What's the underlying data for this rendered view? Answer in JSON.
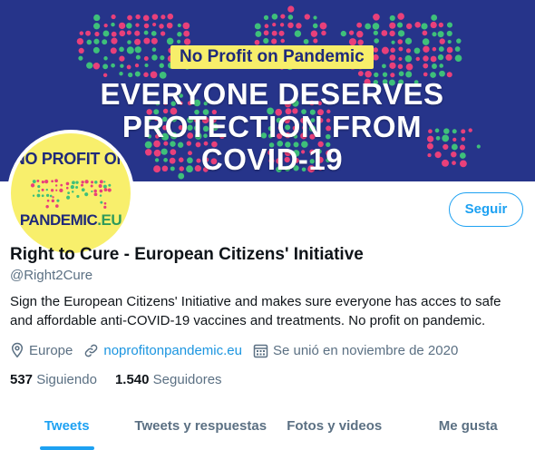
{
  "banner": {
    "pill_text": "No Profit on Pandemic",
    "headline_line1": "EVERYONE DESERVES",
    "headline_line2": "PROTECTION FROM",
    "headline_line3": "COVID-19",
    "colors": {
      "background": "#26348a",
      "pill": "#f7ee6a",
      "dots_pink": "#e9407a",
      "dots_green": "#3ec07a"
    }
  },
  "avatar": {
    "line1": "NO PROFIT ON",
    "line2": "PANDEMIC",
    "line2_suffix": ".EU",
    "colors": {
      "background": "#f8ef6c",
      "text": "#1f2a7a"
    }
  },
  "profile": {
    "name": "Right to Cure - European Citizens' Initiative",
    "handle": "@Right2Cure",
    "bio": "Sign the European Citizens' Initiative and makes sure everyone has acces to safe and affordable anti-COVID-19 vaccines and treatments. No profit on pandemic.",
    "location": "Europe",
    "location_icon": "location-pin-icon",
    "website": "noprofitonpandemic.eu",
    "website_icon": "link-icon",
    "joined": "Se unió en noviembre de 2020",
    "joined_icon": "calendar-icon",
    "following_count": "537",
    "following_label": "Siguiendo",
    "followers_count": "1.540",
    "followers_label": "Seguidores"
  },
  "actions": {
    "follow_label": "Seguir"
  },
  "tabs": [
    {
      "label": "Tweets",
      "active": true
    },
    {
      "label": "Tweets y respuestas",
      "active": false
    },
    {
      "label": "Fotos y videos",
      "active": false
    },
    {
      "label": "Me gusta",
      "active": false
    }
  ],
  "colors": {
    "accent": "#1da1f2",
    "secondary_text": "#5b7083",
    "link": "#1b95e0"
  }
}
